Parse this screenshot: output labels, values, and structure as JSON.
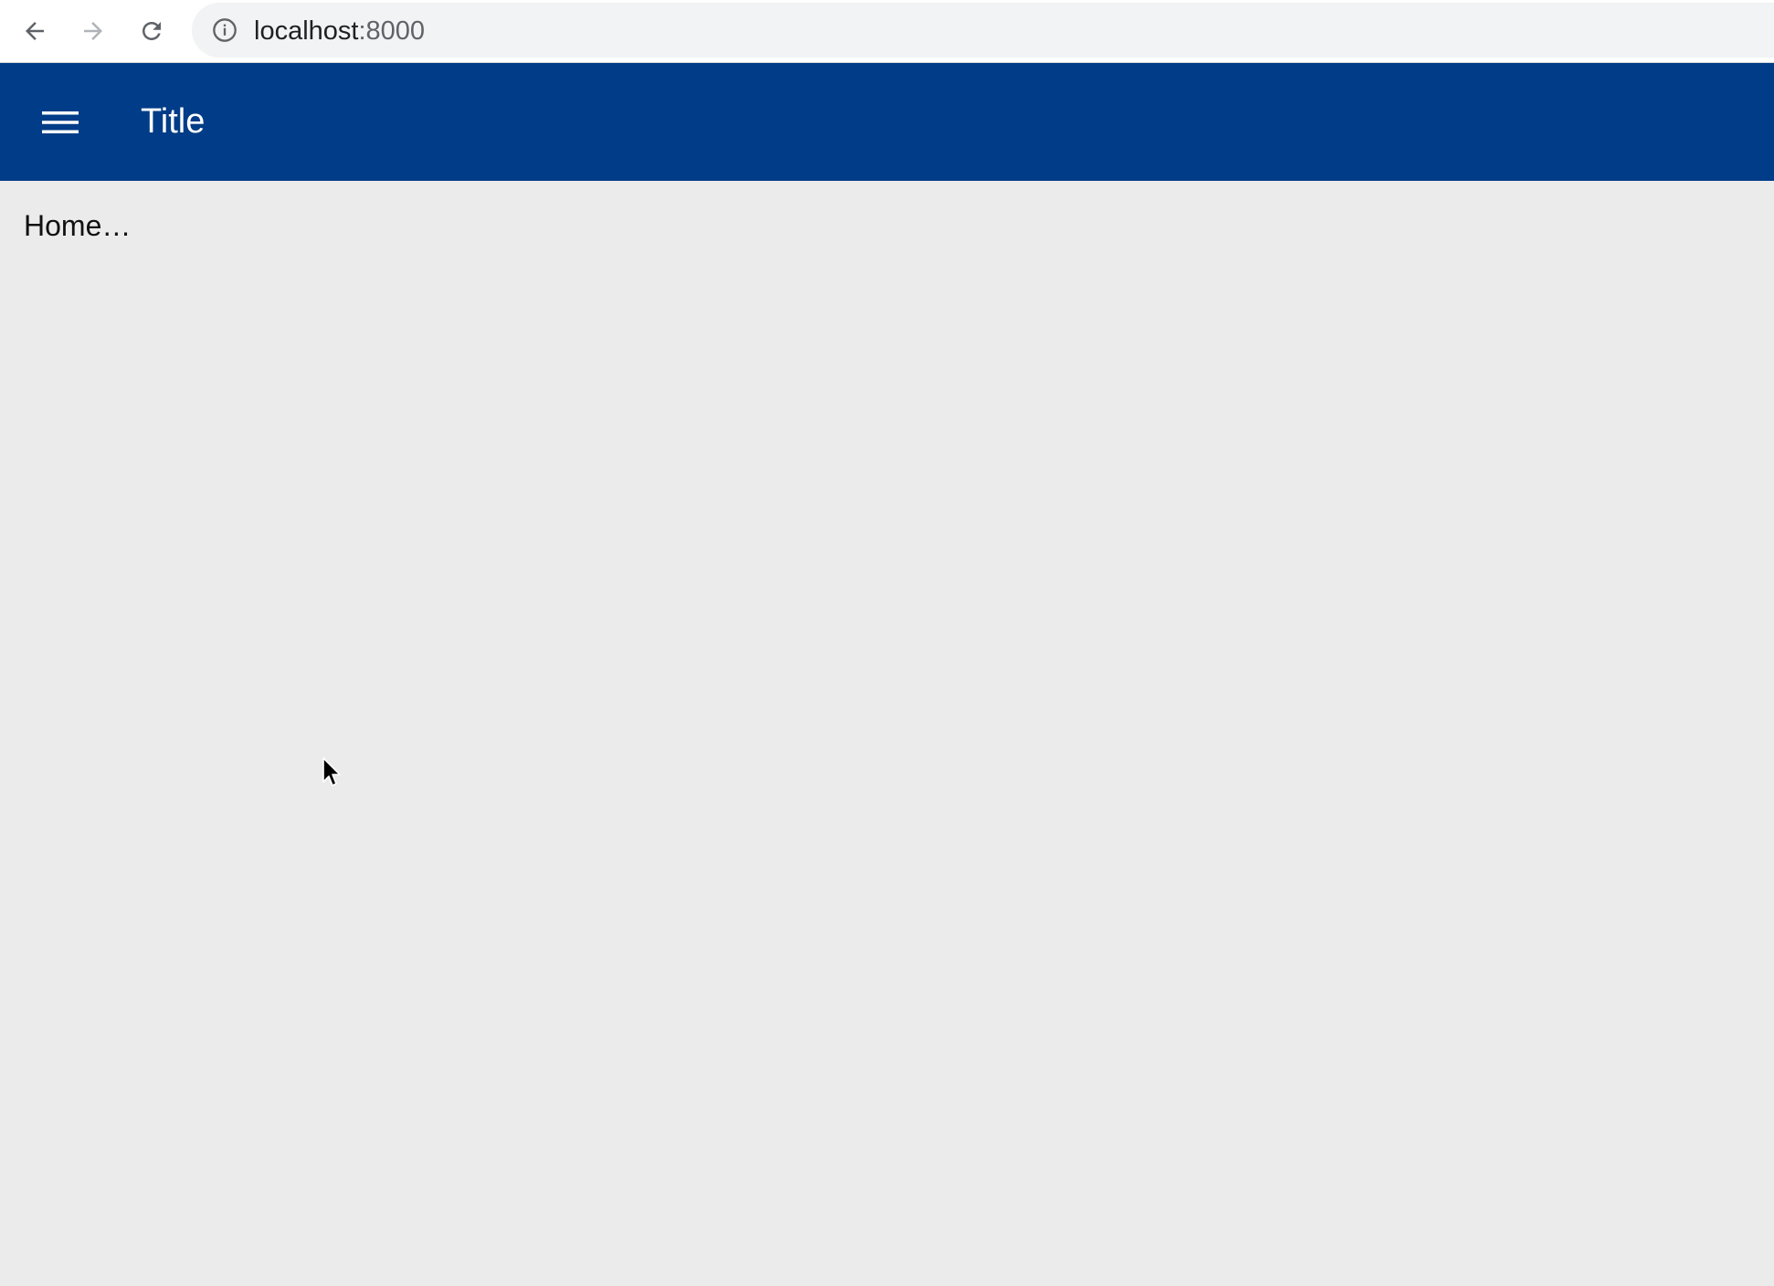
{
  "browser": {
    "url_host": "localhost",
    "url_port": ":8000",
    "icons": {
      "back": "arrow-left-icon",
      "forward": "arrow-right-icon",
      "reload": "reload-icon",
      "info": "info-icon"
    }
  },
  "app_bar": {
    "title": "Title",
    "menu_icon": "hamburger-menu-icon",
    "color": "#003c87"
  },
  "main": {
    "text": "Home…"
  },
  "colors": {
    "background": "#ebebeb",
    "app_bar": "#003c87",
    "title_text": "#ffffff"
  }
}
